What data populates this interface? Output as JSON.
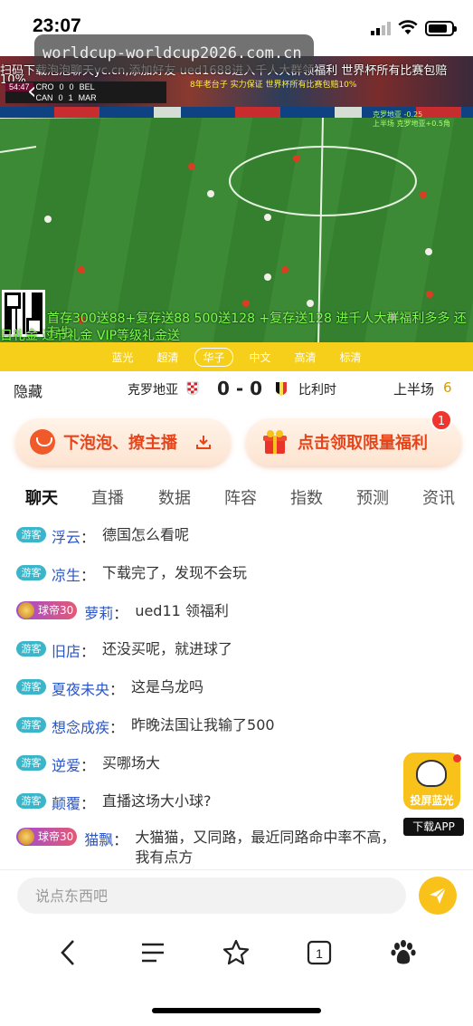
{
  "status_bar": {
    "time": "23:07"
  },
  "browser": {
    "url": "worldcup-worldcup2026.com.cn"
  },
  "video": {
    "marquee_line1": "扫码下载泡泡聊天yc.cn,添加好友 ued1688进入千人大群领福利 世界杯所有比赛包赔",
    "marquee_line2": "10%",
    "scoreboard": {
      "clock": "54:47",
      "row1": {
        "home": "CRO",
        "home_score": "0",
        "away_score": "0",
        "away": "BEL"
      },
      "row2": {
        "home": "CAN",
        "home_score": "0",
        "away_score": "1",
        "away": "MAR"
      }
    },
    "overlay_yellow": "8年老台子 实力保证 世界杯所有比赛包赔10%",
    "overlay_green": [
      "克罗地亚 -0.25",
      "上半场 克罗地亚+0.5角"
    ],
    "promo_line1": "首存300送88+复存送88 500送128 +复存送128 进千人大群福利多多 还有生",
    "promo_line2": "日礼金 过节礼金 VIP等级礼金送"
  },
  "channels": [
    {
      "label": "蓝光",
      "active": false
    },
    {
      "label": "超清",
      "active": false
    },
    {
      "label": "华子",
      "active": true
    },
    {
      "label": "中文",
      "active": false
    },
    {
      "label": "高清",
      "active": false
    },
    {
      "label": "标清",
      "active": false
    }
  ],
  "match": {
    "hide_label": "隐藏",
    "home_team": "克罗地亚",
    "score": "0 - 0",
    "away_team": "比利时",
    "period": "上半场",
    "minute": "6"
  },
  "promo_buttons": {
    "left_label": "下泡泡、撩主播",
    "right_label": "点击领取限量福利",
    "badge_count": "1"
  },
  "tabs": [
    "聊天",
    "直播",
    "数据",
    "阵容",
    "指数",
    "预测",
    "资讯"
  ],
  "chat": {
    "guest_badge": "游客",
    "messages": [
      {
        "badge": "游客",
        "badge_type": "guest",
        "user": "浮云",
        "text": "德国怎么看呢"
      },
      {
        "badge": "游客",
        "badge_type": "guest",
        "user": "凉生",
        "text": "下载完了，发现不会玩"
      },
      {
        "badge": "球帝30",
        "badge_type": "rank",
        "user": "萝莉",
        "text": "ued11 领福利"
      },
      {
        "badge": "游客",
        "badge_type": "guest",
        "user": "旧店",
        "text": "还没买呢，就进球了"
      },
      {
        "badge": "游客",
        "badge_type": "guest",
        "user": "夏夜未央",
        "text": "这是乌龙吗"
      },
      {
        "badge": "游客",
        "badge_type": "guest",
        "user": "想念成疾",
        "text": "昨晚法国让我输了500"
      },
      {
        "badge": "游客",
        "badge_type": "guest",
        "user": "逆爱",
        "text": "买哪场大"
      },
      {
        "badge": "游客",
        "badge_type": "guest",
        "user": "颠覆",
        "text": "直播这场大小球?"
      },
      {
        "badge": "球帝30",
        "badge_type": "rank",
        "user": "猫飘",
        "text": "大猫猫，又同路，最近同路命中率不高，我有点方"
      }
    ]
  },
  "float_app": {
    "caption": "投屏蓝光",
    "download": "下载APP"
  },
  "input": {
    "placeholder": "说点东西吧"
  },
  "colors": {
    "accent_yellow": "#f8c21a",
    "channel_bar": "#f6cf1b",
    "promo_red": "#e8441a",
    "guest_badge": "#3bb5c9",
    "username_blue": "#2a55c6"
  }
}
